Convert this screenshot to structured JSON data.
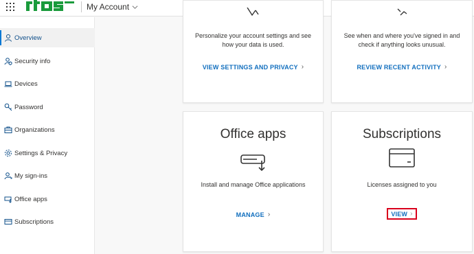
{
  "header": {
    "app_title": "My Account"
  },
  "sidebar": {
    "items": [
      {
        "label": "Overview",
        "icon": "person-icon",
        "active": true
      },
      {
        "label": "Security info",
        "icon": "security-person-icon"
      },
      {
        "label": "Devices",
        "icon": "laptop-icon"
      },
      {
        "label": "Password",
        "icon": "key-icon"
      },
      {
        "label": "Organizations",
        "icon": "briefcase-icon"
      },
      {
        "label": "Settings & Privacy",
        "icon": "gear-icon"
      },
      {
        "label": "My sign-ins",
        "icon": "person-sign-in-icon"
      },
      {
        "label": "Office apps",
        "icon": "office-apps-icon"
      },
      {
        "label": "Subscriptions",
        "icon": "card-icon"
      }
    ]
  },
  "cards": {
    "settings_privacy": {
      "description": "Personalize your account settings and see how your data is used.",
      "link": "VIEW SETTINGS AND PRIVACY"
    },
    "sign_ins": {
      "description": "See when and where you've signed in and check if anything looks unusual.",
      "link": "REVIEW RECENT ACTIVITY"
    },
    "office_apps": {
      "title": "Office apps",
      "description": "Install and manage Office applications",
      "link": "MANAGE"
    },
    "subscriptions": {
      "title": "Subscriptions",
      "description": "Licenses assigned to you",
      "link": "VIEW"
    }
  },
  "colors": {
    "accent": "#0078d4",
    "link": "#106ebe",
    "logo": "#1a9b3c",
    "highlight": "#d9001b"
  }
}
